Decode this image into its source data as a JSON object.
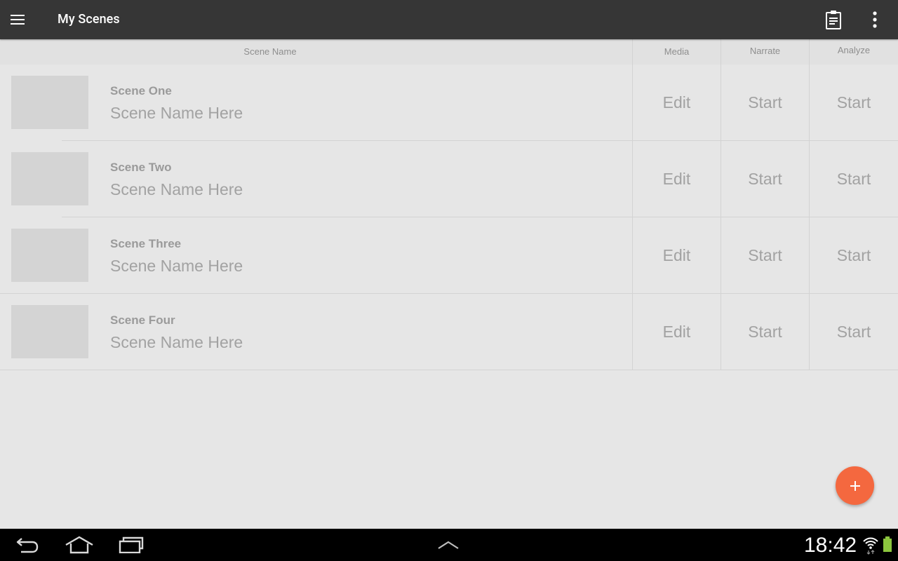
{
  "appbar": {
    "title": "My Scenes",
    "menu_icon": "hamburger-menu-icon",
    "clipboard_icon": "clipboard-icon",
    "overflow_icon": "more-vert-icon",
    "background_color": "#363636"
  },
  "columns": {
    "scene_name": "Scene Name",
    "media": "Media",
    "narrate": "Narrate",
    "analyze": "Analyze"
  },
  "scenes": [
    {
      "title": "Scene One",
      "subtitle": "Scene Name Here",
      "media": "Edit",
      "narrate": "Start",
      "analyze": "Start"
    },
    {
      "title": "Scene Two",
      "subtitle": "Scene Name Here",
      "media": "Edit",
      "narrate": "Start",
      "analyze": "Start"
    },
    {
      "title": "Scene Three",
      "subtitle": "Scene Name Here",
      "media": "Edit",
      "narrate": "Start",
      "analyze": "Start"
    },
    {
      "title": "Scene Four",
      "subtitle": "Scene Name Here",
      "media": "Edit",
      "narrate": "Start",
      "analyze": "Start"
    }
  ],
  "fab": {
    "icon": "plus-icon",
    "color": "#f4683f"
  },
  "system_bar": {
    "time": "18:42",
    "back_icon": "back-icon",
    "home_icon": "home-icon",
    "recents_icon": "recents-icon",
    "up_icon": "chevron-up-icon",
    "wifi_icon": "wifi-icon",
    "battery_icon": "battery-icon",
    "battery_color": "#8cc63e"
  }
}
